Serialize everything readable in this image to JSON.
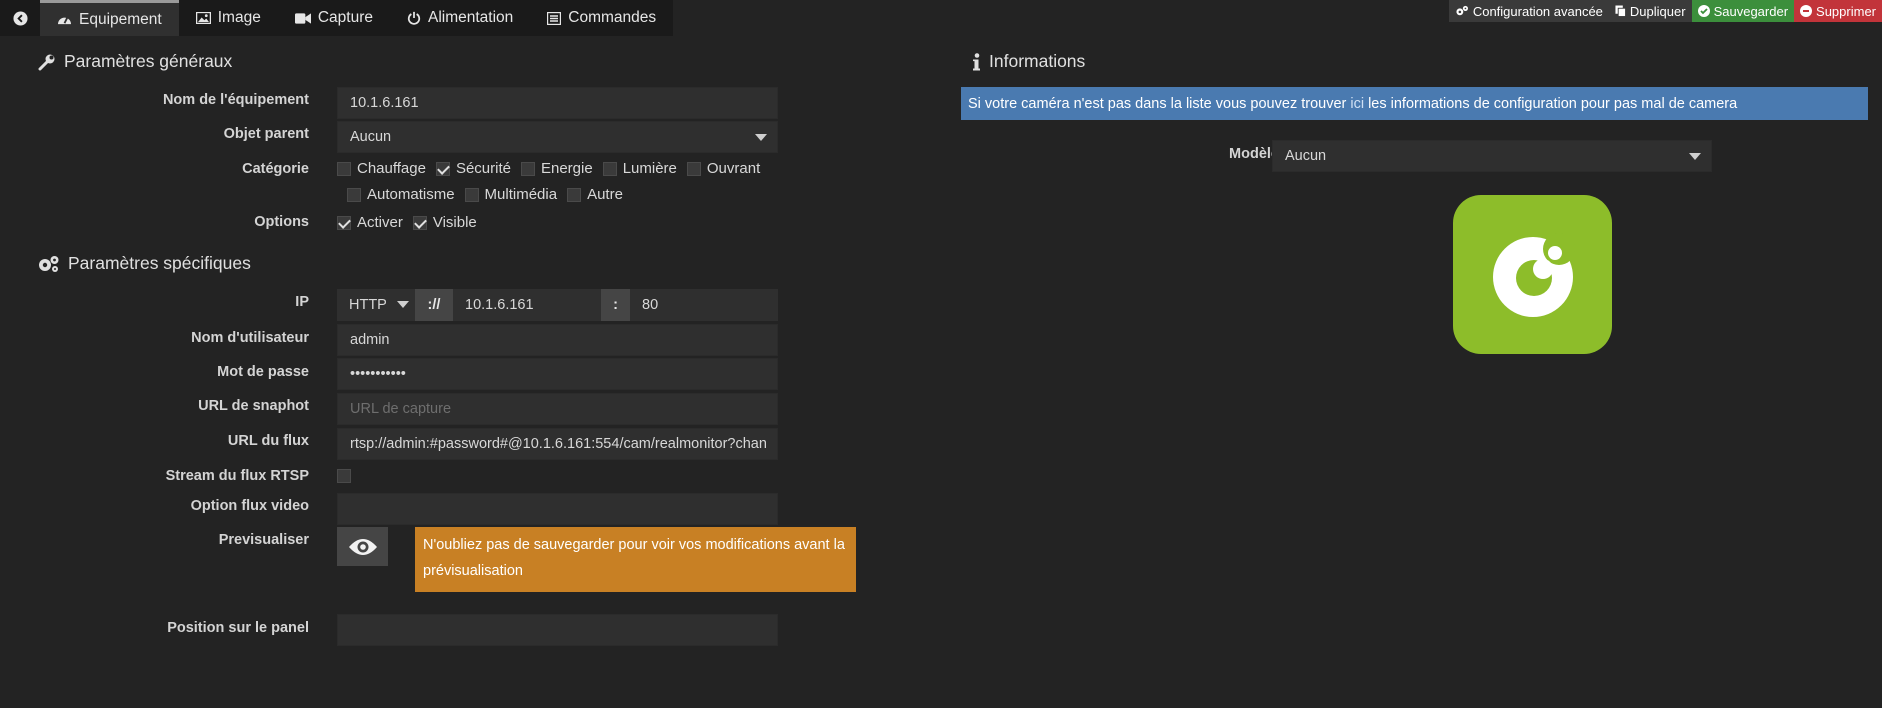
{
  "tabs": [
    {
      "label": "",
      "icon": "back-arrow-icon"
    },
    {
      "label": "Equipement",
      "icon": "dashboard-icon",
      "active": true
    },
    {
      "label": "Image",
      "icon": "image-icon"
    },
    {
      "label": "Capture",
      "icon": "video-camera-icon"
    },
    {
      "label": "Alimentation",
      "icon": "power-icon"
    },
    {
      "label": "Commandes",
      "icon": "list-icon"
    }
  ],
  "actions": {
    "advanced": "Configuration avancée",
    "duplicate": "Dupliquer",
    "save": "Sauvegarder",
    "delete": "Supprimer"
  },
  "general": {
    "title": "Paramètres généraux",
    "name_label": "Nom de l'équipement",
    "name_value": "10.1.6.161",
    "parent_label": "Objet parent",
    "parent_value": "Aucun",
    "category_label": "Catégorie",
    "categories": [
      {
        "label": "Chauffage",
        "checked": false
      },
      {
        "label": "Sécurité",
        "checked": true
      },
      {
        "label": "Energie",
        "checked": false
      },
      {
        "label": "Lumière",
        "checked": false
      },
      {
        "label": "Ouvrant",
        "checked": false
      },
      {
        "label": "Automatisme",
        "checked": false
      },
      {
        "label": "Multimédia",
        "checked": false
      },
      {
        "label": "Autre",
        "checked": false
      }
    ],
    "options_label": "Options",
    "options": [
      {
        "label": "Activer",
        "checked": true
      },
      {
        "label": "Visible",
        "checked": true
      }
    ]
  },
  "specific": {
    "title": "Paramètres spécifiques",
    "ip_label": "IP",
    "protocol": "HTTP",
    "scheme_sep": "://",
    "ip_value": "10.1.6.161",
    "port_sep": ":",
    "port_value": "80",
    "user_label": "Nom d'utilisateur",
    "user_value": "admin",
    "password_label": "Mot de passe",
    "password_value": "•••••••••••",
    "snapshot_label": "URL de snaphot",
    "snapshot_placeholder": "URL de capture",
    "stream_label": "URL du flux",
    "stream_value": "rtsp://admin:#password#@10.1.6.161:554/cam/realmonitor?chan",
    "rtsp_label": "Stream du flux RTSP",
    "rtsp_checked": false,
    "video_option_label": "Option flux video",
    "video_option_value": "",
    "preview_label": "Previsualiser",
    "preview_warning": "N'oubliez pas de sauvegarder pour voir vos modifications avant la prévisualisation",
    "position_label": "Position sur le panel",
    "position_value": ""
  },
  "info": {
    "title": "Informations",
    "banner_before": "Si votre caméra n'est pas dans la liste vous pouvez trouver",
    "banner_link": "ici",
    "banner_after": "les informations de configuration pour pas mal de camera",
    "model_label": "Modèle",
    "model_value": "Aucun"
  },
  "colors": {
    "background": "#232323",
    "info_banner": "#4a7ab0",
    "warning": "#c88024",
    "save": "#3c8f3c",
    "delete": "#c2343a",
    "logo": "#8dbd2a"
  }
}
